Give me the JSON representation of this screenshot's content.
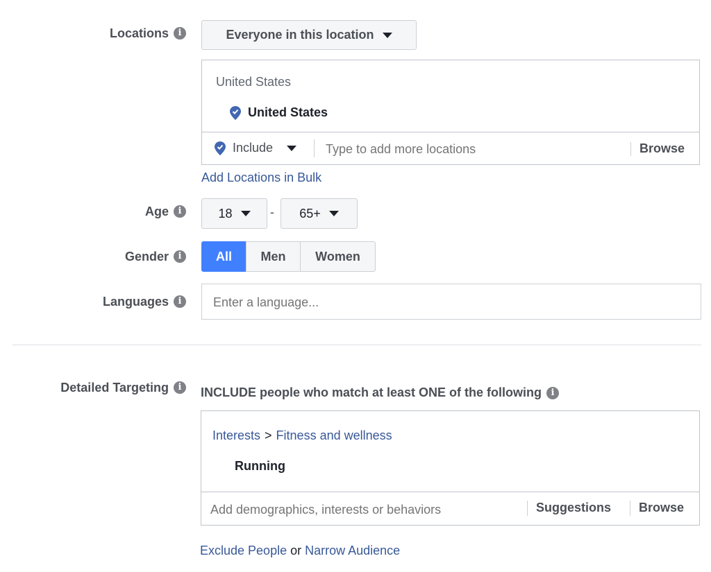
{
  "locations": {
    "label": "Locations",
    "audience_dropdown": "Everyone in this location",
    "group_header": "United States",
    "selected": [
      "United States"
    ],
    "mode": "Include",
    "input_placeholder": "Type to add more locations",
    "browse_label": "Browse",
    "bulk_link": "Add Locations in Bulk"
  },
  "age": {
    "label": "Age",
    "min": "18",
    "separator": "-",
    "max": "65+"
  },
  "gender": {
    "label": "Gender",
    "options": [
      "All",
      "Men",
      "Women"
    ],
    "selected": "All"
  },
  "languages": {
    "label": "Languages",
    "placeholder": "Enter a language..."
  },
  "detailed_targeting": {
    "label": "Detailed Targeting",
    "include_heading": "INCLUDE people who match at least ONE of the following",
    "breadcrumb": [
      "Interests",
      "Fitness and wellness"
    ],
    "breadcrumb_sep": ">",
    "selected_item": "Running",
    "input_placeholder": "Add demographics, interests or behaviors",
    "suggestions_label": "Suggestions",
    "browse_label": "Browse",
    "exclude_link": "Exclude People",
    "or_text": "or",
    "narrow_link": "Narrow Audience"
  },
  "colors": {
    "accent": "#4080ff",
    "link": "#385898",
    "pin": "#4267b2"
  },
  "icons": [
    "info-icon",
    "caret-down-icon",
    "location-pin-icon"
  ]
}
